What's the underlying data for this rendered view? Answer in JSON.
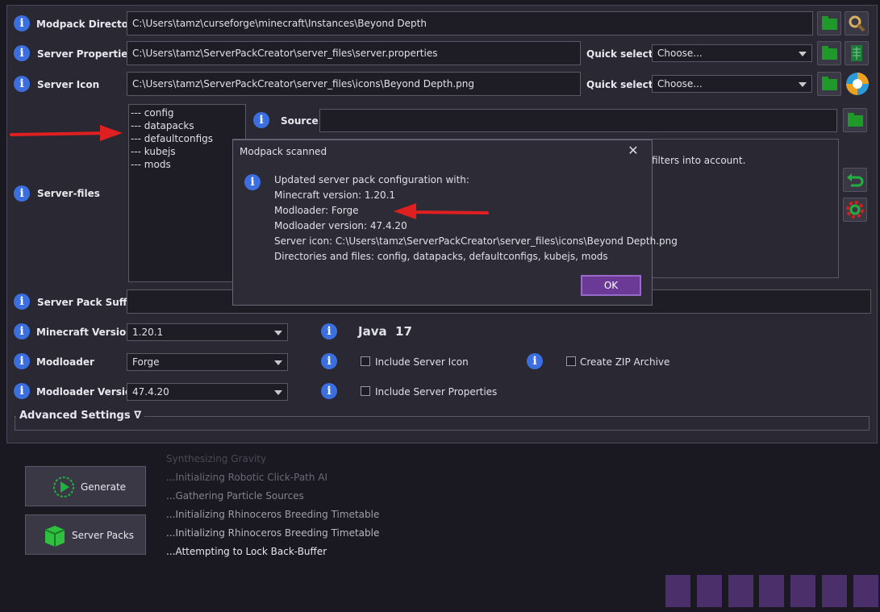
{
  "rows": {
    "modpack_directory": {
      "label": "Modpack Directory",
      "value": "C:\\Users\\tamz\\curseforge\\minecraft\\Instances\\Beyond Depth"
    },
    "server_properties": {
      "label": "Server Properties",
      "value": "C:\\Users\\tamz\\ServerPackCreator\\server_files\\server.properties",
      "quick_select_label": "Quick select:",
      "quick_select_value": "Choose..."
    },
    "server_icon": {
      "label": "Server Icon",
      "value": "C:\\Users\\tamz\\ServerPackCreator\\server_files\\icons\\Beyond Depth.png",
      "quick_select_label": "Quick select:",
      "quick_select_value": "Choose..."
    },
    "server_files": {
      "label": "Server-files",
      "tree": [
        "--- config",
        "--- datapacks",
        "--- defaultconfigs",
        "--- kubejs",
        "--- mods"
      ],
      "source_label": "Source:",
      "source_value": "",
      "hint_text": "filters into account."
    },
    "server_pack_suffix": {
      "label": "Server Pack Suffix",
      "value": ""
    },
    "minecraft_version": {
      "label": "Minecraft Version",
      "value": "1.20.1",
      "java_text": "Java  17"
    },
    "modloader": {
      "label": "Modloader",
      "value": "Forge",
      "include_server_icon": "Include Server Icon",
      "create_zip": "Create ZIP Archive"
    },
    "modloader_version": {
      "label": "Modloader Version",
      "value": "47.4.20",
      "include_server_properties": "Include Server Properties"
    }
  },
  "advanced_settings": "Advanced Settings ∇",
  "buttons": {
    "generate": "Generate",
    "server_packs": "Server Packs"
  },
  "log_lines": [
    {
      "text": "Synthesizing Gravity",
      "color": "#4a4856"
    },
    {
      "text": "...Initializing Robotic Click-Path AI",
      "color": "#6a6876"
    },
    {
      "text": "...Gathering Particle Sources",
      "color": "#84828f"
    },
    {
      "text": "...Initializing Rhinoceros Breeding Timetable",
      "color": "#9f9daa"
    },
    {
      "text": "...Initializing Rhinoceros Breeding Timetable",
      "color": "#bab8c4"
    },
    {
      "text": "...Attempting to Lock Back-Buffer",
      "color": "#e6e6ee"
    }
  ],
  "dialog": {
    "title": "Modpack scanned",
    "lines": [
      "Updated server pack configuration with:",
      "Minecraft version: 1.20.1",
      "Modloader: Forge",
      "Modloader version: 47.4.20",
      "Server icon: C:\\Users\\tamz\\ServerPackCreator\\server_files\\icons\\Beyond Depth.png",
      "Directories and files: config, datapacks, defaultconfigs, kubejs, mods"
    ],
    "ok": "OK"
  },
  "colors": {
    "accent_purple": "#6a3a96",
    "folder_green": "#1f9a2a",
    "info_blue": "#3b6fe0",
    "arrow_red": "#e02020"
  }
}
